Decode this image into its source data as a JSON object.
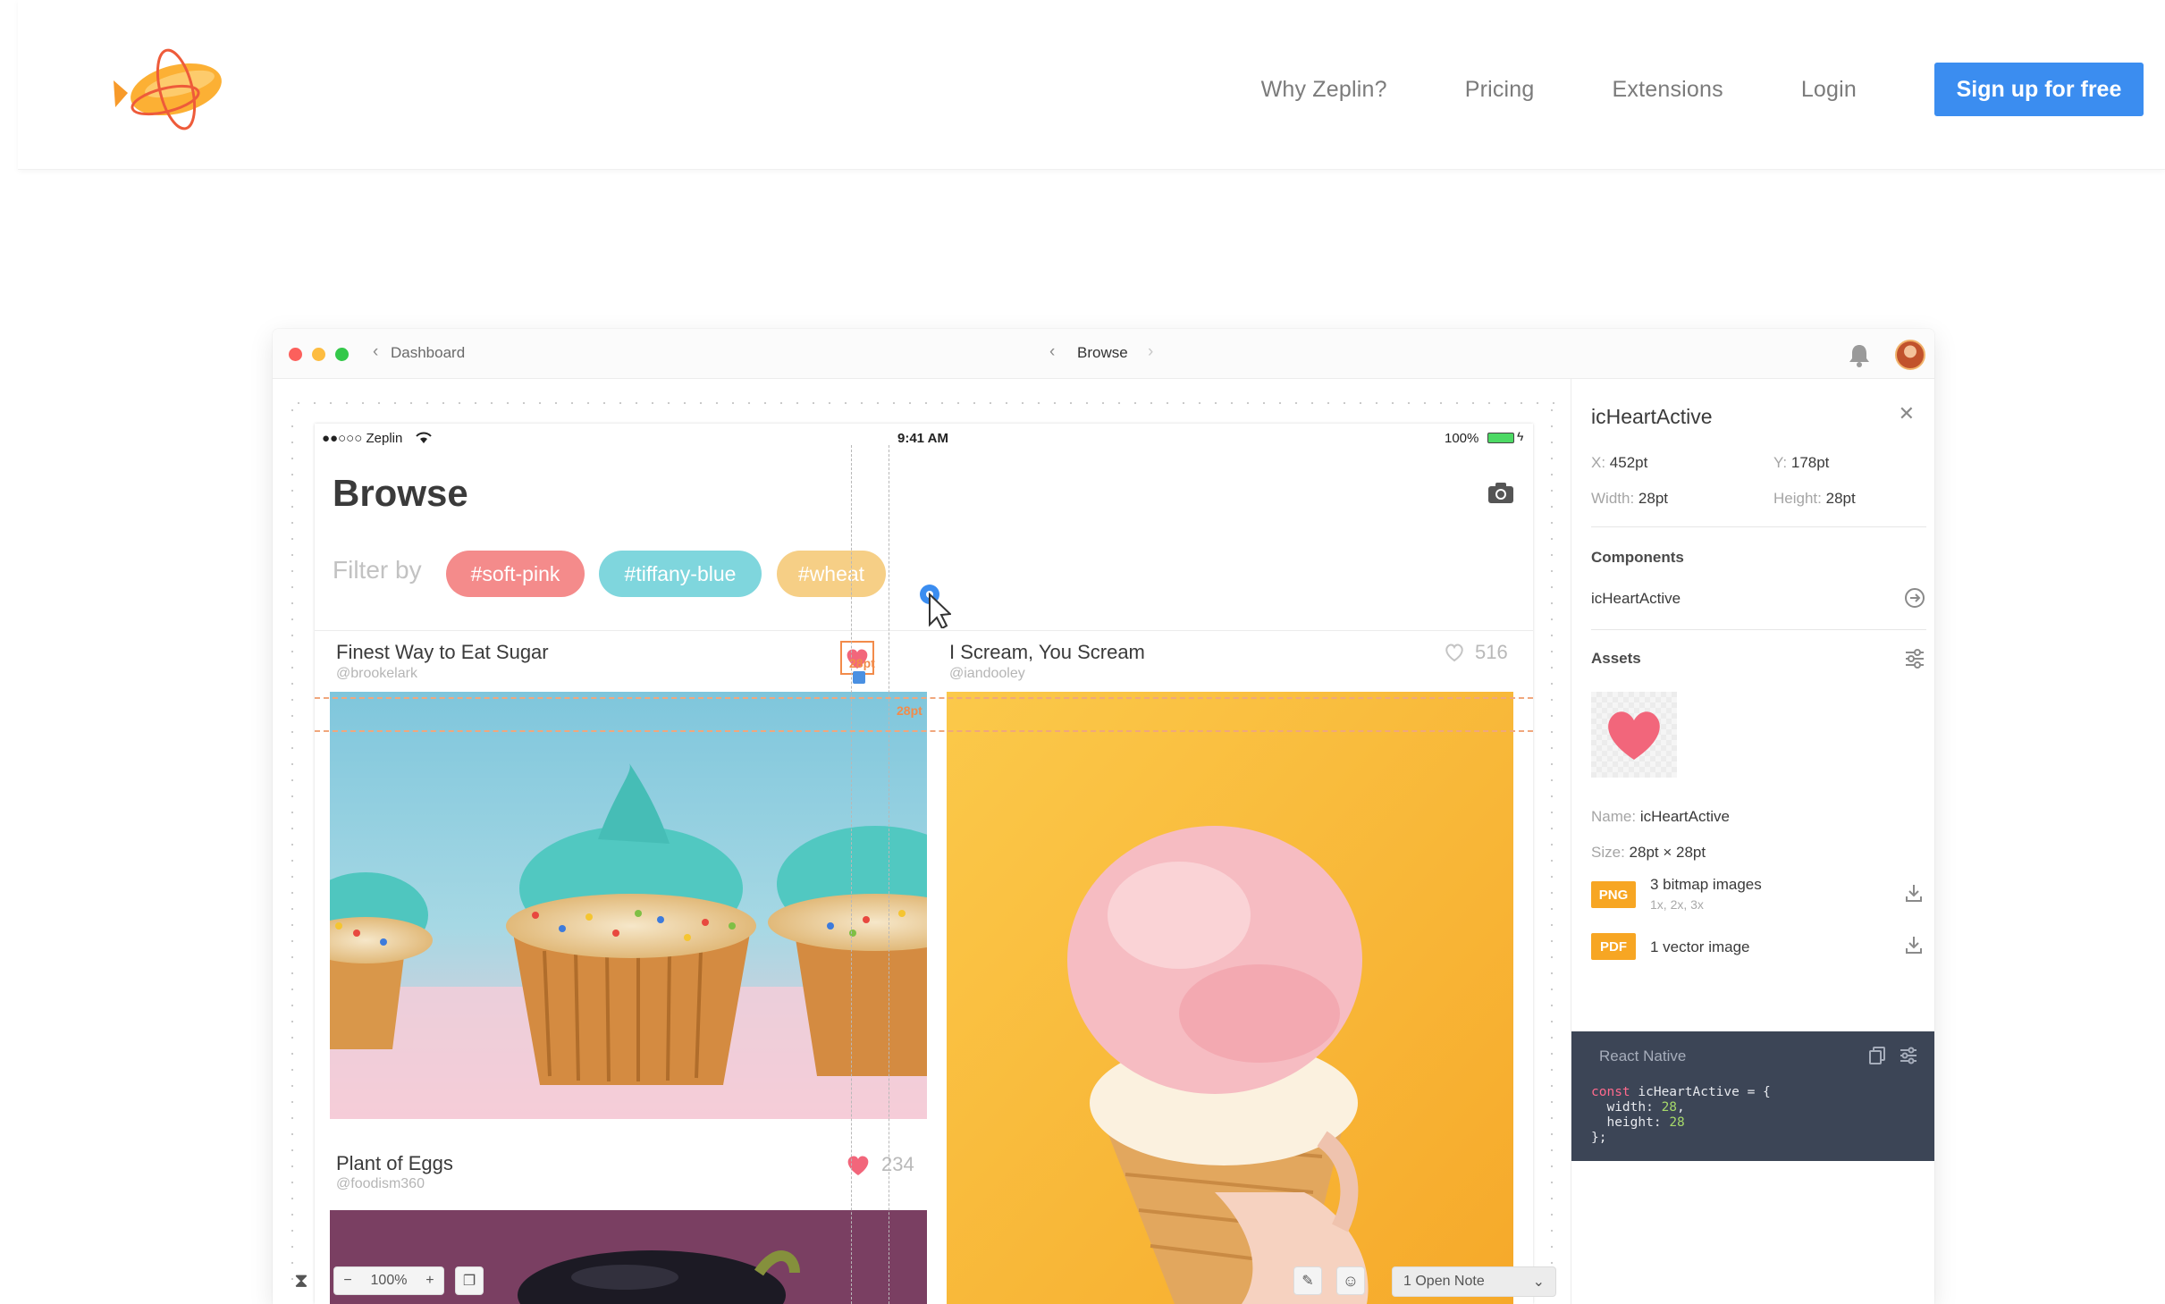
{
  "site_nav": {
    "links": [
      "Why Zeplin?",
      "Pricing",
      "Extensions",
      "Login"
    ],
    "cta": "Sign up for free"
  },
  "titlebar": {
    "back_label": "Dashboard",
    "center_label": "Browse"
  },
  "device": {
    "carrier": "●●○○○ Zeplin",
    "time": "9:41 AM",
    "battery": "100%",
    "page_title": "Browse",
    "filter_label": "Filter by",
    "chips": [
      {
        "label": "#soft-pink",
        "color": "#f48b8b"
      },
      {
        "label": "#tiffany-blue",
        "color": "#7fd6dd"
      },
      {
        "label": "#wheat",
        "color": "#f6cf86"
      }
    ],
    "posts": [
      {
        "title": "Finest Way to Eat Sugar",
        "author": "@brookelark"
      },
      {
        "title": "I Scream, You Scream",
        "author": "@iandooley",
        "likes": "516"
      },
      {
        "title": "Plant of Eggs",
        "author": "@foodism360",
        "likes": "234"
      }
    ],
    "measure_top": "28pt",
    "measure_side": "28pt"
  },
  "bottom_toolbar": {
    "zoom": "100%",
    "minus": "−",
    "plus": "+",
    "notes": "1 Open Note"
  },
  "inspector": {
    "title": "icHeartActive",
    "x_key": "X:",
    "x_val": "452pt",
    "y_key": "Y:",
    "y_val": "178pt",
    "w_key": "Width:",
    "w_val": "28pt",
    "h_key": "Height:",
    "h_val": "28pt",
    "components_heading": "Components",
    "component_name": "icHeartActive",
    "assets_heading": "Assets",
    "name_key": "Name:",
    "name_val": "icHeartActive",
    "size_key": "Size:",
    "size_val": "28pt × 28pt",
    "png_tag": "PNG",
    "png_label": "3 bitmap images",
    "png_sub": "1x, 2x, 3x",
    "pdf_tag": "PDF",
    "pdf_label": "1 vector image",
    "code_platform": "React Native",
    "code": {
      "line1_kw": "const",
      "line1_rest": " icHeartActive = {",
      "line2_key": "  width: ",
      "line2_val": "28",
      "line2_end": ",",
      "line3_key": "  height: ",
      "line3_val": "28",
      "line4": "};"
    }
  },
  "colors": {
    "accent_blue": "#3b8df0",
    "heart_pink": "#f2667b",
    "measure_orange": "#f28b4a",
    "code_bg": "#3c4556"
  }
}
